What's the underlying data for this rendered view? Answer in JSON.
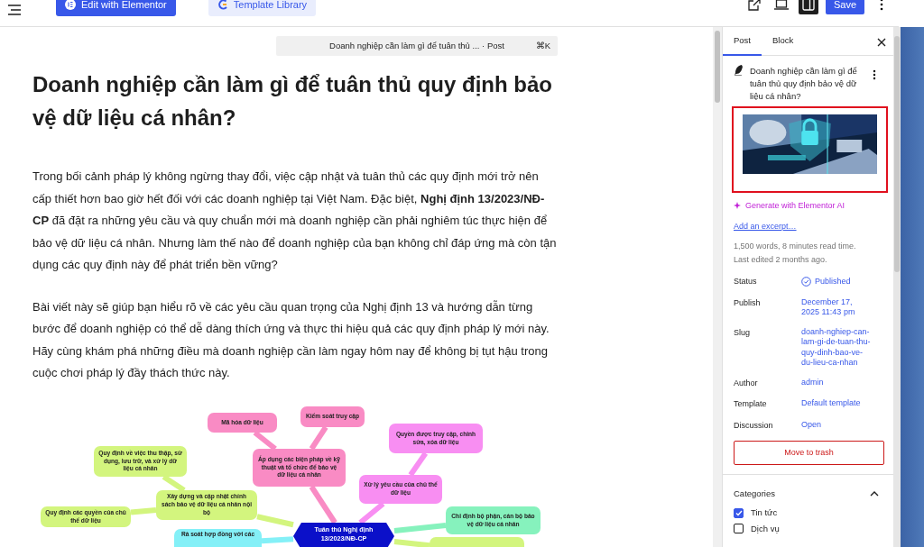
{
  "toolbar": {
    "buttons": [
      {
        "label": "Edit with Elementor",
        "kind": "primary"
      },
      {
        "label": "Template Library",
        "kind": "secondary"
      }
    ],
    "save": "Save"
  },
  "command_bar": {
    "text": "Doanh nghiệp cần làm gì để tuân thủ ... · Post",
    "shortcut": "⌘K"
  },
  "post": {
    "title": "Doanh nghiệp cần làm gì để tuân thủ quy định bảo vệ dữ liệu cá nhân?",
    "paragraphs": [
      "Trong bối cảnh pháp lý không ngừng thay đổi, việc cập nhật và tuân thủ các quy định mới trở nên cấp thiết hơn bao giờ hết đối với các doanh nghiệp tại Việt Nam. Đặc biệt, **Nghị định 13/2023/NĐ-CP** đã đặt ra những yêu cầu và quy chuẩn mới mà doanh nghiệp cần phải nghiêm túc thực hiện để bảo vệ dữ liệu cá nhân. Nhưng làm thế nào để doanh nghiệp của bạn không chỉ đáp ứng mà còn tận dụng các quy định này để phát triển bền vững?",
      "Bài viết này sẽ giúp bạn hiểu rõ về các yêu cầu quan trọng của Nghị định 13 và hướng dẫn từng bước để doanh nghiệp có thể dễ dàng thích ứng và thực thi hiệu quả các quy định pháp lý mới này. Hãy cùng khám phá những điều mà doanh nghiệp cần làm ngay hôm nay để không bị tụt hậu trong cuộc chơi pháp lý đầy thách thức này."
    ],
    "mindmap": {
      "text": "Tuân thủ Nghị định 13/2023/NĐ-CP",
      "color": "#0b10c9",
      "children": [
        {
          "text": "Áp dụng các biện pháp về kỹ thuật và tổ chức để bảo vệ dữ liệu cá nhân",
          "color": "#f98bc4",
          "children": [
            {
              "text": "Mã hóa dữ liệu",
              "color": "#f98bc4"
            },
            {
              "text": "Kiểm soát truy cập",
              "color": "#f98bc4"
            }
          ]
        },
        {
          "text": "Xử lý yêu cầu của chủ thể dữ liệu",
          "color": "#f88ef2",
          "children": [
            {
              "text": "Quyền được truy cập, chỉnh sửa, xóa dữ liệu",
              "color": "#f88ef2"
            }
          ]
        },
        {
          "text": "Xây dựng và cập nhật chính sách bảo vệ dữ liệu cá nhân nội bộ",
          "color": "#d3f57e",
          "children": [
            {
              "text": "Quy định về việc thu thập, sử dụng, lưu trữ, và xử lý dữ liệu cá nhân",
              "color": "#d3f57e"
            },
            {
              "text": "Quy định các quyền của chủ thể dữ liệu",
              "color": "#d3f57e"
            }
          ]
        },
        {
          "text": "Chỉ định bộ phận, cán bộ bảo vệ dữ liệu cá nhân",
          "color": "#86f2bd"
        },
        {
          "text": "Rà soát hợp đồng với các",
          "color": "#84f0f7"
        },
        {
          "color": "#d3f57e"
        }
      ]
    }
  },
  "sidebar": {
    "tabs": [
      {
        "label": "Post",
        "selected": true
      },
      {
        "label": "Block",
        "selected": false
      }
    ],
    "post_title": "Doanh nghiệp cần làm gì để tuân thủ quy định bảo vệ dữ liệu cá nhân?",
    "ai_link": "Generate with Elementor AI",
    "excerpt_link": "Add an excerpt…",
    "meta": [
      "1,500 words, 8 minutes read time.",
      "Last edited 2 months ago."
    ],
    "fields": [
      {
        "label": "Status",
        "value": "Published",
        "kind": "status"
      },
      {
        "label": "Publish",
        "value": "December 17, 2025 11:43 pm",
        "kind": "link"
      },
      {
        "label": "Slug",
        "value": "doanh-nghiep-can-lam-gi-de-tuan-thu-quy-dinh-bao-ve-du-lieu-ca-nhan",
        "kind": "link"
      },
      {
        "label": "Author",
        "value": "admin",
        "kind": "link"
      },
      {
        "label": "Template",
        "value": "Default template",
        "kind": "link"
      },
      {
        "label": "Discussion",
        "value": "Open",
        "kind": "link"
      }
    ],
    "trash": "Move to trash",
    "categories": {
      "title": "Categories",
      "expanded": true,
      "items": [
        {
          "label": "Tin tức",
          "checked": true
        },
        {
          "label": "Dịch vụ",
          "checked": false
        }
      ]
    }
  }
}
